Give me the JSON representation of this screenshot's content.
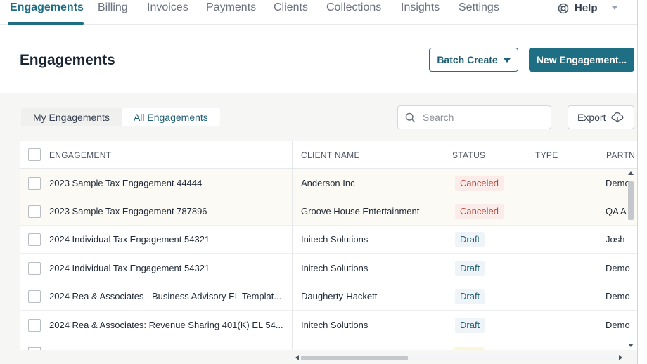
{
  "nav": {
    "items": [
      {
        "label": "Engagements",
        "active": true
      },
      {
        "label": "Billing"
      },
      {
        "label": "Invoices"
      },
      {
        "label": "Payments"
      },
      {
        "label": "Clients"
      },
      {
        "label": "Collections"
      },
      {
        "label": "Insights"
      },
      {
        "label": "Settings"
      }
    ],
    "help_label": "Help",
    "help_icon": "lifebuoy-icon"
  },
  "header": {
    "title": "Engagements",
    "batch_create_label": "Batch Create",
    "new_engagement_label": "New Engagement..."
  },
  "toolbar": {
    "tabs": [
      {
        "label": "My Engagements",
        "active": false
      },
      {
        "label": "All Engagements",
        "active": true
      }
    ],
    "search_placeholder": "Search",
    "export_label": "Export"
  },
  "table": {
    "headers": {
      "engagement": "ENGAGEMENT",
      "client": "CLIENT NAME",
      "status": "STATUS",
      "type": "TYPE",
      "partner": "PARTN"
    },
    "rows": [
      {
        "engagement": "2023 Sample Tax Engagement 44444",
        "client": "Anderson Inc",
        "status": "Canceled",
        "type": "",
        "partner": "Demo"
      },
      {
        "engagement": "2023 Sample Tax Engagement 787896",
        "client": "Groove House Entertainment",
        "status": "Canceled",
        "type": "",
        "partner": "QA A"
      },
      {
        "engagement": "2024 Individual Tax Engagement 54321",
        "client": "Initech Solutions",
        "status": "Draft",
        "type": "",
        "partner": "Josh"
      },
      {
        "engagement": "2024 Individual Tax Engagement 54321",
        "client": "Initech Solutions",
        "status": "Draft",
        "type": "",
        "partner": "Demo"
      },
      {
        "engagement": "2024 Rea & Associates - Business Advisory EL Templat...",
        "client": "Daugherty-Hackett",
        "status": "Draft",
        "type": "",
        "partner": "Demo"
      },
      {
        "engagement": "2024 Rea & Associates: Revenue Sharing 401(K) EL 54...",
        "client": "Initech Solutions",
        "status": "Draft",
        "type": "",
        "partner": "Demo"
      }
    ]
  },
  "colors": {
    "accent": "#1f6f84",
    "canceled_bg": "#fbecea",
    "canceled_text": "#c0463a",
    "draft_bg": "#eef4f8"
  }
}
